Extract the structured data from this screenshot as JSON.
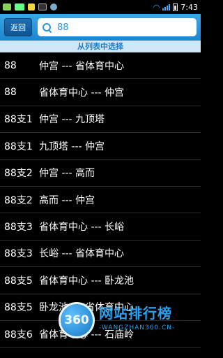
{
  "status_bar": {
    "time": "7:43"
  },
  "toolbar": {
    "back_label": "返回",
    "search_value": "88"
  },
  "header": {
    "title": "从列表中选择"
  },
  "routes": [
    {
      "route": "88",
      "desc": "仲宫 --- 省体育中心"
    },
    {
      "route": "88",
      "desc": "省体育中心 --- 仲宫"
    },
    {
      "route": "88支1",
      "desc": "仲宫 --- 九顶塔"
    },
    {
      "route": "88支1",
      "desc": "九顶塔 --- 仲宫"
    },
    {
      "route": "88支2",
      "desc": "仲宫 --- 高而"
    },
    {
      "route": "88支2",
      "desc": "高而 --- 仲宫"
    },
    {
      "route": "88支3",
      "desc": "省体育中心 --- 长峪"
    },
    {
      "route": "88支3",
      "desc": "长峪 --- 省体育中心"
    },
    {
      "route": "88支5",
      "desc": "省体育中心 --- 卧龙池"
    },
    {
      "route": "88支5",
      "desc": "卧龙池 --- 省体育中心"
    },
    {
      "route": "88支6",
      "desc": "省体育中心 --- 石庙岭"
    }
  ],
  "watermark": {
    "badge": "360",
    "title": "网站排行榜",
    "subtitle": "-WANGZHAN360.CN-"
  }
}
